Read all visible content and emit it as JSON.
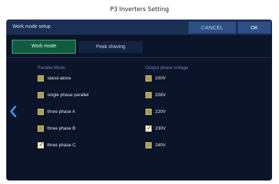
{
  "caption": "P3 Inverters Setting",
  "header": {
    "title": "Work mode setup",
    "cancel_label": "CANCEL",
    "ok_label": "OK"
  },
  "tabs": [
    {
      "label": "Work mode",
      "active": true
    },
    {
      "label": "Peak shaving",
      "active": false
    }
  ],
  "parallel_mode": {
    "header": "Parallel Mode",
    "options": [
      {
        "label": "stand-alone",
        "checked": false
      },
      {
        "label": "single phase parallel",
        "checked": false
      },
      {
        "label": "three phase A",
        "checked": false
      },
      {
        "label": "three phase B",
        "checked": false
      },
      {
        "label": "three phase C",
        "checked": true
      }
    ]
  },
  "output_voltage": {
    "header": "Output phase voltage",
    "options": [
      {
        "label": "200V",
        "checked": false
      },
      {
        "label": "208V",
        "checked": false
      },
      {
        "label": "220V",
        "checked": false
      },
      {
        "label": "230V",
        "checked": true
      },
      {
        "label": "240V",
        "checked": false
      }
    ]
  },
  "colors": {
    "accent": "#37b582",
    "panel_bg": "#0b1428",
    "checkbox": "#a89e55",
    "nav_arrow": "#3aa0ff"
  },
  "icons": {
    "back": "chevron-left-icon",
    "check": "checkmark-icon"
  }
}
